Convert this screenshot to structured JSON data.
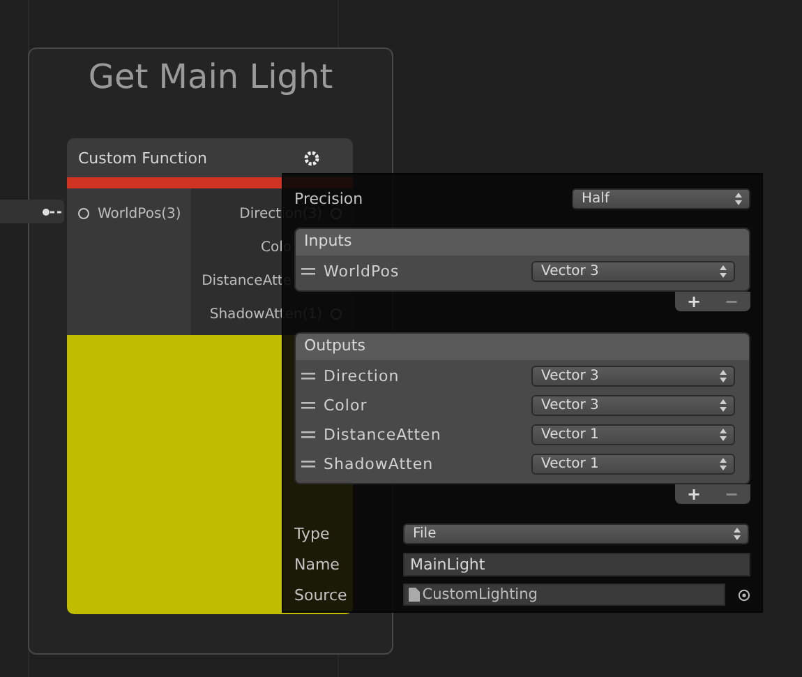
{
  "node_group": {
    "title": "Get Main Light"
  },
  "node": {
    "title": "Custom Function",
    "inputs": [
      {
        "label": "WorldPos(3)"
      }
    ],
    "outputs": [
      {
        "label": "Direction(3)",
        "covered": false
      },
      {
        "label": "Colo",
        "covered": true
      },
      {
        "label": "DistanceAtte",
        "covered": true
      },
      {
        "label": "ShadowAtten(1)",
        "covered": false
      }
    ]
  },
  "inspector": {
    "precision": {
      "label": "Precision",
      "value": "Half"
    },
    "inputs": {
      "title": "Inputs",
      "add": "+",
      "remove": "−",
      "items": [
        {
          "name": "WorldPos",
          "type": "Vector 3"
        }
      ]
    },
    "outputs": {
      "title": "Outputs",
      "add": "+",
      "remove": "−",
      "items": [
        {
          "name": "Direction",
          "type": "Vector 3"
        },
        {
          "name": "Color",
          "type": "Vector 3"
        },
        {
          "name": "DistanceAtten",
          "type": "Vector 1"
        },
        {
          "name": "ShadowAtten",
          "type": "Vector 1"
        }
      ]
    },
    "fields": [
      {
        "label": "Type",
        "kind": "dropdown",
        "value": "File"
      },
      {
        "label": "Name",
        "kind": "text",
        "value": "MainLight"
      },
      {
        "label": "Source",
        "kind": "object",
        "value": "CustomLighting"
      }
    ]
  }
}
